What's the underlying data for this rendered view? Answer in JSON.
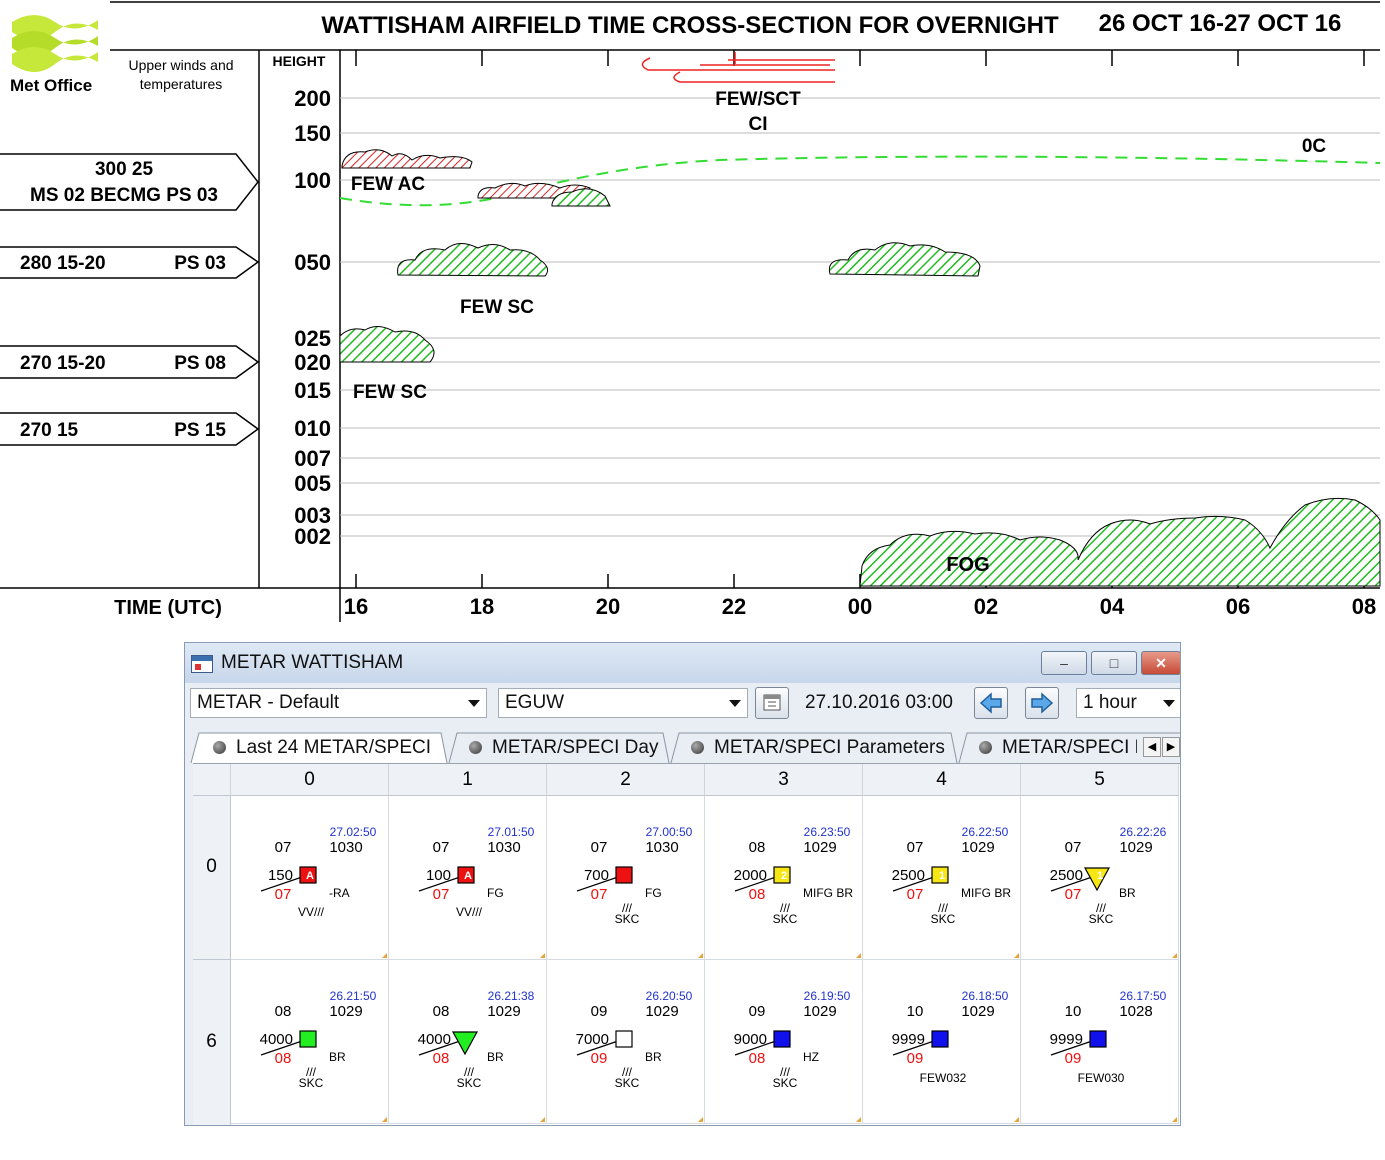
{
  "xsec": {
    "title": "WATTISHAM AIRFIELD TIME CROSS-SECTION FOR OVERNIGHT",
    "dates": "26 OCT 16-27 OCT 16",
    "brand": "Met Office",
    "upper_winds_line1": "Upper winds and",
    "upper_winds_line2": "temperatures",
    "height_label": "HEIGHT",
    "time_label": "TIME (UTC)",
    "height_ticks": [
      "200",
      "150",
      "100",
      "050",
      "025",
      "020",
      "015",
      "010",
      "007",
      "005",
      "003",
      "002"
    ],
    "time_ticks": [
      "16",
      "18",
      "20",
      "22",
      "00",
      "02",
      "04",
      "06",
      "08"
    ],
    "winds": [
      {
        "line1": "300 25",
        "line2": "MS 02 BECMG PS 03"
      },
      {
        "left": "280 15-20",
        "right": "PS 03"
      },
      {
        "left": "270 15-20",
        "right": "PS 08"
      },
      {
        "left": "270 15",
        "right": "PS 15"
      }
    ],
    "labels": {
      "ci_1": "FEW/SCT",
      "ci_2": "CI",
      "freezing": "0C",
      "ac": "FEW AC",
      "sc_mid": "FEW SC",
      "sc_low": "FEW SC",
      "fog": "FOG"
    },
    "colors": {
      "cloud_hatch": "#22bb22",
      "ac_hatch": "#dd2222",
      "freezing_line": "#33dd33",
      "cirrus": "#ee2222"
    }
  },
  "metar_window": {
    "title": "METAR WATTISHAM",
    "profile": "METAR - Default",
    "station": "EGUW",
    "datetime": "27.10.2016 03:00",
    "interval": "1 hour",
    "tabs": [
      "Last 24 METAR/SPECI",
      "METAR/SPECI Day",
      "METAR/SPECI Parameters",
      "METAR/SPECI R"
    ],
    "columns": [
      "0",
      "1",
      "2",
      "3",
      "4",
      "5"
    ],
    "rows": [
      "0",
      "6"
    ],
    "cells": [
      {
        "time": "27.02:50",
        "cover": "07",
        "pres": "1030",
        "vis": "150",
        "dew": "07",
        "wx": "-RA",
        "cloud": "VV///",
        "sym": "A",
        "fill": "#ee1111",
        "shape": "square"
      },
      {
        "time": "27.01:50",
        "cover": "07",
        "pres": "1030",
        "vis": "100",
        "dew": "07",
        "wx": "FG",
        "cloud": "VV///",
        "sym": "A",
        "fill": "#ee1111",
        "shape": "square"
      },
      {
        "time": "27.00:50",
        "cover": "07",
        "pres": "1030",
        "vis": "700",
        "dew": "07",
        "wx": "FG",
        "cloud": "SKC",
        "sym": "",
        "fill": "#ee1111",
        "shape": "square"
      },
      {
        "time": "26.23:50",
        "cover": "08",
        "pres": "1029",
        "vis": "2000",
        "dew": "08",
        "wx": "MIFG BR",
        "cloud": "SKC",
        "sym": "2",
        "fill": "#f5e614",
        "shape": "square"
      },
      {
        "time": "26.22:50",
        "cover": "07",
        "pres": "1029",
        "vis": "2500",
        "dew": "07",
        "wx": "MIFG BR",
        "cloud": "SKC",
        "sym": "1",
        "fill": "#f5e614",
        "shape": "square"
      },
      {
        "time": "26.22:26",
        "cover": "07",
        "pres": "1029",
        "vis": "2500",
        "dew": "07",
        "wx": "BR",
        "cloud": "SKC",
        "sym": "1",
        "fill": "#f5e614",
        "shape": "triangle"
      },
      {
        "time": "26.21:50",
        "cover": "08",
        "pres": "1029",
        "vis": "4000",
        "dew": "08",
        "wx": "BR",
        "cloud": "SKC",
        "sym": "",
        "fill": "#22ee22",
        "shape": "square"
      },
      {
        "time": "26.21:38",
        "cover": "08",
        "pres": "1029",
        "vis": "4000",
        "dew": "08",
        "wx": "BR",
        "cloud": "SKC",
        "sym": "",
        "fill": "#22ee22",
        "shape": "triangle"
      },
      {
        "time": "26.20:50",
        "cover": "09",
        "pres": "1029",
        "vis": "7000",
        "dew": "09",
        "wx": "BR",
        "cloud": "SKC",
        "sym": "",
        "fill": "#ffffff",
        "shape": "square"
      },
      {
        "time": "26.19:50",
        "cover": "09",
        "pres": "1029",
        "vis": "9000",
        "dew": "08",
        "wx": "HZ",
        "cloud": "SKC",
        "sym": "",
        "fill": "#1111ee",
        "shape": "square"
      },
      {
        "time": "26.18:50",
        "cover": "10",
        "pres": "1029",
        "vis": "9999",
        "dew": "09",
        "wx": "",
        "cloud": "FEW032",
        "sym": "",
        "fill": "#1111ee",
        "shape": "square"
      },
      {
        "time": "26.17:50",
        "cover": "10",
        "pres": "1028",
        "vis": "9999",
        "dew": "09",
        "wx": "",
        "cloud": "FEW030",
        "sym": "",
        "fill": "#1111ee",
        "shape": "square"
      }
    ]
  }
}
